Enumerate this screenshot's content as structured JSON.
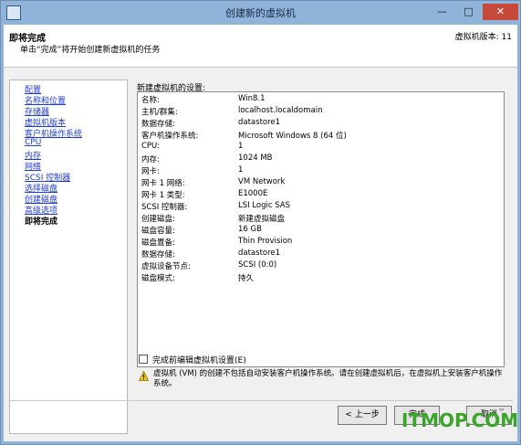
{
  "window": {
    "title": "创建新的虚拟机",
    "minimize": "—",
    "maximize": "□",
    "close": "✕"
  },
  "header": {
    "title": "即将完成",
    "subtitle": "单击“完成”将开始创建新虚拟机的任务",
    "version": "虚拟机版本: 11"
  },
  "nav": {
    "items": [
      {
        "label": "配置"
      },
      {
        "label": "名称和位置"
      },
      {
        "label": "存储器"
      },
      {
        "label": "虚拟机版本"
      },
      {
        "label": "客户机操作系统"
      },
      {
        "label": "CPU"
      },
      {
        "label": "内存"
      },
      {
        "label": "网络"
      },
      {
        "label": "SCSI 控制器"
      },
      {
        "label": "选择磁盘"
      },
      {
        "label": "创建磁盘"
      },
      {
        "label": "高级选项"
      },
      {
        "label": "即将完成"
      }
    ]
  },
  "settings": {
    "label": "新建虚拟机的设置:",
    "rows": [
      {
        "key": "名称:",
        "value": "Win8.1"
      },
      {
        "key": "主机/群集:",
        "value": "localhost.localdomain"
      },
      {
        "key": "数据存储:",
        "value": "datastore1"
      },
      {
        "key": "客户机操作系统:",
        "value": "Microsoft Windows 8 (64 位)"
      },
      {
        "key": "CPU:",
        "value": "1"
      },
      {
        "key": "内存:",
        "value": "1024 MB"
      },
      {
        "key": "网卡:",
        "value": "1"
      },
      {
        "key": "网卡 1 网络:",
        "value": "VM Network"
      },
      {
        "key": "网卡 1 类型:",
        "value": "E1000E"
      },
      {
        "key": "SCSI 控制器:",
        "value": "LSI Logic SAS"
      },
      {
        "key": "创建磁盘:",
        "value": "新建虚拟磁盘"
      },
      {
        "key": "磁盘容量:",
        "value": "16 GB"
      },
      {
        "key": "磁盘置备:",
        "value": "Thin Provision"
      },
      {
        "key": "数据存储:",
        "value": "datastore1"
      },
      {
        "key": "虚拟设备节点:",
        "value": "SCSI (0:0)"
      },
      {
        "key": "磁盘模式:",
        "value": "持久"
      }
    ]
  },
  "edit_checkbox": {
    "label": "完成前编辑虚拟机设置(E)",
    "checked": false
  },
  "warning": {
    "text": "虚拟机 (VM) 的创建不包括自动安装客户机操作系统。请在创建虚拟机后，在虚拟机上安装客户机操作系统。"
  },
  "buttons": {
    "back": "< 上一步",
    "finish": "完成",
    "cancel": "取消"
  },
  "watermark": {
    "text": "ITMOP.COM",
    "small": "™"
  }
}
